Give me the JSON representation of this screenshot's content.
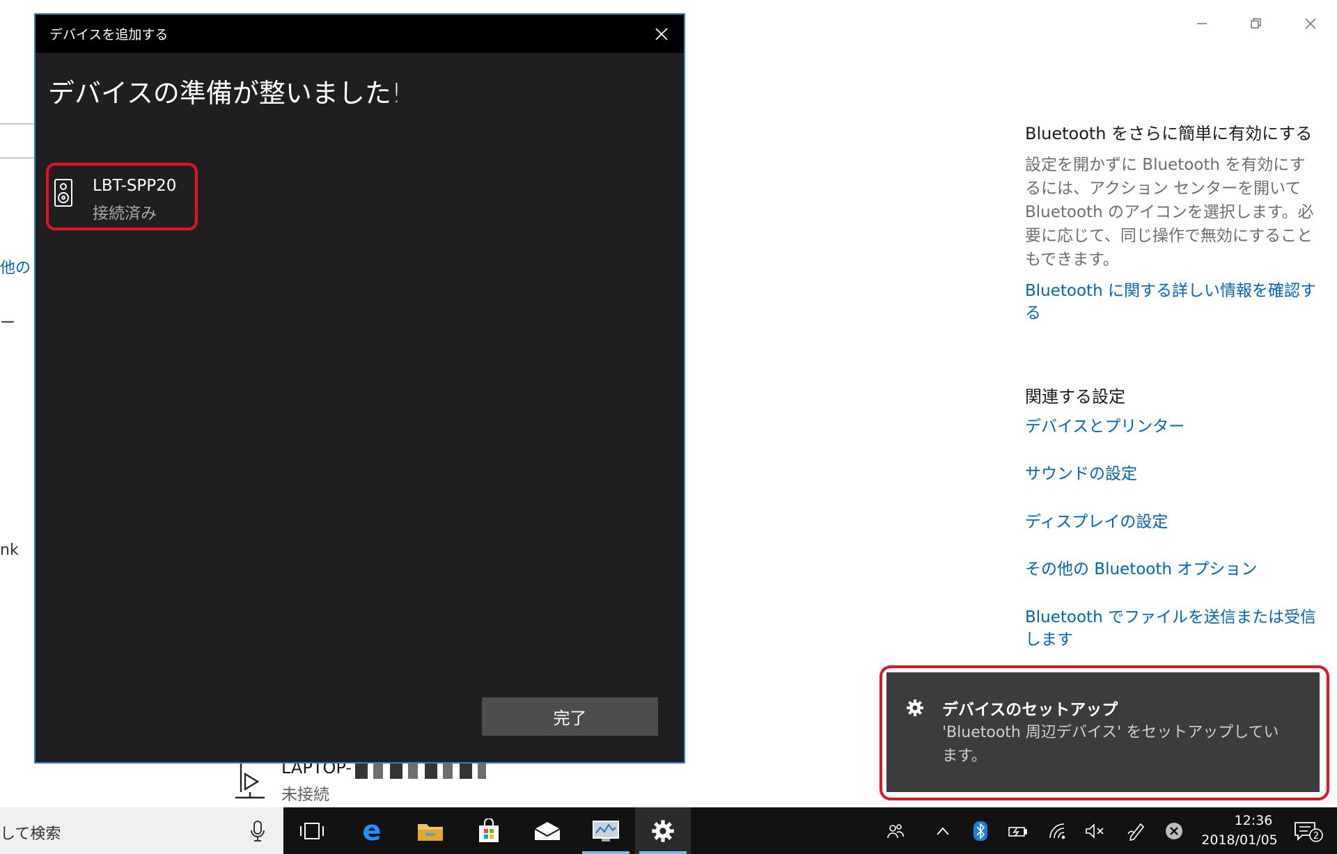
{
  "background": {
    "left_fragments": [
      "他の",
      "ー",
      "nk"
    ],
    "sidebar": {
      "quick_heading": "Bluetooth をさらに簡単に有効にする",
      "quick_body": "設定を開かずに Bluetooth を有効にするには、アクション センターを開いて Bluetooth のアイコンを選択します。必要に応じて、同じ操作で無効にすることもできます。",
      "learn_more_link": "Bluetooth に関する詳しい情報を確認する",
      "related_heading": "関連する設定",
      "links": [
        "デバイスとプリンター",
        "サウンドの設定",
        "ディスプレイの設定",
        "その他の Bluetooth オプション",
        "Bluetooth でファイルを送信または受信します"
      ]
    },
    "device_list_item": {
      "name": "LAPTOP-",
      "status": "未接続"
    }
  },
  "dialog": {
    "title": "デバイスを追加する",
    "heading": "デバイスの準備が整いました!",
    "device": {
      "name": "LBT-SPP20",
      "status": "接続済み",
      "icon": "speaker-icon"
    },
    "done_label": "完了"
  },
  "toast": {
    "icon": "gear-icon",
    "title": "デバイスのセットアップ",
    "body": "'Bluetooth 周辺デバイス' をセットアップしています。"
  },
  "taskbar": {
    "search_text": "して検索",
    "apps": [
      "task-view-icon",
      "edge-icon",
      "file-explorer-icon",
      "store-icon",
      "mail-icon",
      "monitor-app-icon",
      "settings-icon"
    ],
    "active_app": "settings-icon",
    "clock": {
      "time": "12:36",
      "date": "2018/01/05"
    },
    "notification_count": "2"
  },
  "colors": {
    "link": "#0067b8",
    "highlight_red": "#e81123",
    "dialog_bg": "#1f1f1f",
    "toast_bg": "#3c3c3c",
    "taskbar_bg": "#121212"
  }
}
